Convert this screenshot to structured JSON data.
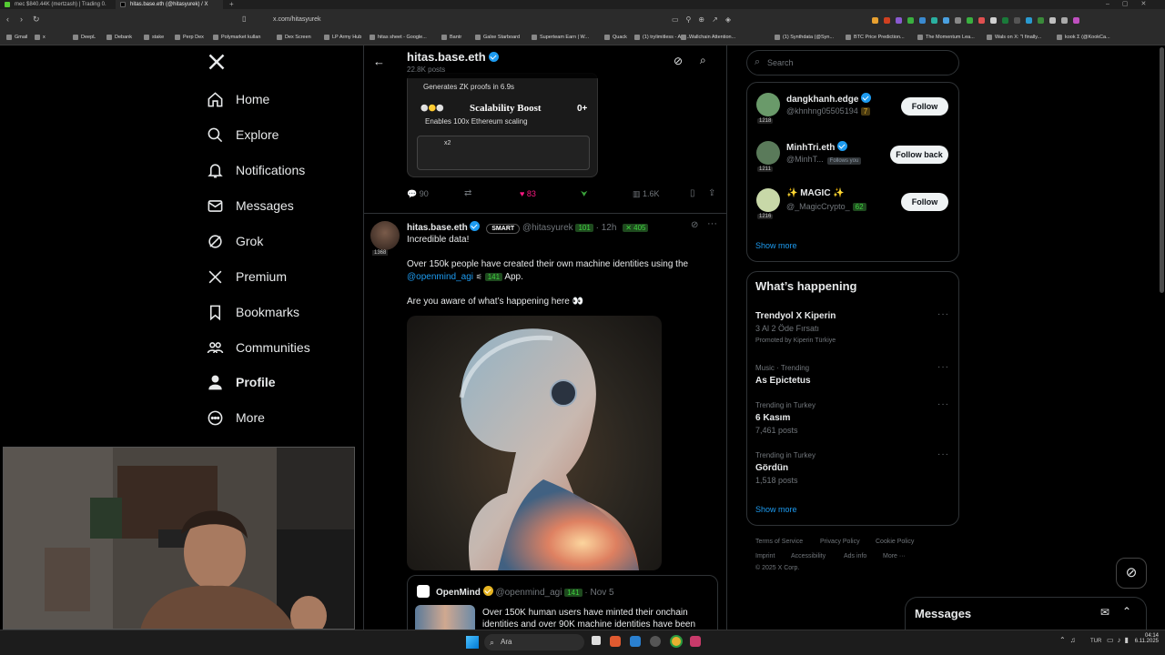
{
  "browser": {
    "tabs": [
      {
        "label": "mec $840.44K (mertzash) | Trading 0.",
        "active": false
      },
      {
        "label": "hitas.base.eth (@hitasyurek) / X",
        "active": true
      }
    ],
    "url": "x.com/hitasyurek",
    "bookmarks": [
      "Gmail",
      "x",
      "DeepL",
      "Debank",
      "stake",
      "Perp Dex",
      "Polymarket kullan",
      "Dex Screen",
      "LP Army Hub",
      "hitas sheet - Google...",
      "Bantr",
      "Galxe Starboard",
      "Superteam Earn | W...",
      "Quack",
      "(1) trylimitless - Ara...",
      "Wallchain Attention...",
      "(1) Synthdata (@Syn...",
      "BTC Price Prediction...",
      "The Momentum Lea...",
      "Wals on X: \"I finally...",
      "kook Σ (@KookCa..."
    ]
  },
  "nav": {
    "items": [
      {
        "label": "Home",
        "icon": "home-icon"
      },
      {
        "label": "Explore",
        "icon": "search-icon"
      },
      {
        "label": "Notifications",
        "icon": "bell-icon"
      },
      {
        "label": "Messages",
        "icon": "envelope-icon"
      },
      {
        "label": "Grok",
        "icon": "grok-icon"
      },
      {
        "label": "Premium",
        "icon": "x-icon"
      },
      {
        "label": "Bookmarks",
        "icon": "bookmark-icon"
      },
      {
        "label": "Communities",
        "icon": "people-icon"
      },
      {
        "label": "Profile",
        "icon": "person-icon"
      },
      {
        "label": "More",
        "icon": "more-circle-icon"
      }
    ]
  },
  "header": {
    "name": "hitas.base.eth",
    "posts": "22.8K posts"
  },
  "prev_post": {
    "image_text_1": "Generates ZK proofs in 6.9s",
    "image_text_2": "Scalability Boost",
    "image_text_3": "Enables 100x Ethereum scaling",
    "image_text_4": "0+",
    "image_text_5": "x2",
    "replies": "90",
    "likes": "83",
    "views": "1.6K"
  },
  "post": {
    "name": "hitas.base.eth",
    "tag": "SMART",
    "handle": "@hitasyurek",
    "handle_badge": "101",
    "time": "12h",
    "count_badge": "405",
    "avatar_level": "1368",
    "line1": "Incredible data!",
    "line2_prefix": "Over 150k people have created their own machine identities using the",
    "mention": "@openmind_agi",
    "mention_badge": "141",
    "line2_suffix": "App.",
    "line3": "Are you aware of what’s happening here 👀"
  },
  "quote": {
    "name": "OpenMind",
    "handle": "@openmind_agi",
    "badge": "141",
    "date": "Nov 5",
    "text": "Over 150K human users have minted their onchain identities and over 90K machine identities have been"
  },
  "search": {
    "placeholder": "Search"
  },
  "who_to_follow": [
    {
      "name": "dangkhanh.edge",
      "handle": "@khnhng05505194",
      "badge": "7",
      "level": "1218",
      "button": "Follow",
      "follows_you": ""
    },
    {
      "name": "MinhTri.eth",
      "handle": "@MinhT...",
      "badge": "",
      "level": "1211",
      "button": "Follow back",
      "follows_you": "Follows you"
    },
    {
      "name": "✨ MAGIC ✨",
      "handle": "@_MagicCrypto_",
      "badge": "62",
      "level": "1216",
      "button": "Follow",
      "follows_you": ""
    }
  ],
  "show_more": "Show more",
  "happening": {
    "title": "What’s happening",
    "items": [
      {
        "meta": "",
        "title": "Trendyol X Kiperin",
        "sub": "3 Al 2 Öde Fırsatı",
        "promo": "Promoted by Kiperin Türkiye"
      },
      {
        "meta": "Music · Trending",
        "title": "As Epictetus",
        "sub": "",
        "promo": ""
      },
      {
        "meta": "Trending in Turkey",
        "title": "6 Kasım",
        "sub": "7,461 posts",
        "promo": ""
      },
      {
        "meta": "Trending in Turkey",
        "title": "Gördün",
        "sub": "1,518 posts",
        "promo": ""
      }
    ],
    "show_more": "Show more"
  },
  "footer": {
    "links": [
      "Terms of Service",
      "Privacy Policy",
      "Cookie Policy",
      "Imprint",
      "Accessibility",
      "Ads info",
      "More ···"
    ],
    "copyright": "© 2025 X Corp."
  },
  "messages_dock": {
    "title": "Messages"
  },
  "taskbar": {
    "search": "Ara",
    "lang": "TUR",
    "time": "04:14",
    "date": "6.11.2025"
  },
  "colors": {
    "accent": "#1d9bf0",
    "like": "#f91880",
    "background": "#000000"
  }
}
